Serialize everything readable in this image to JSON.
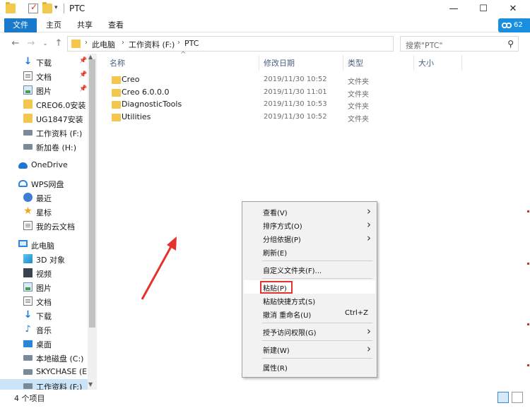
{
  "window": {
    "title": "PTC",
    "minimize": "—",
    "maximize": "☐",
    "close": "✕"
  },
  "ribbon": {
    "tabs": [
      "文件",
      "主页",
      "共享",
      "查看"
    ],
    "badge": "62"
  },
  "address": {
    "crumbs": [
      "此电脑",
      "工作资料 (F:)",
      "PTC"
    ],
    "separator": "›",
    "search_placeholder": "搜索\"PTC\""
  },
  "sidebar": {
    "items": [
      {
        "label": "下载",
        "icon": "download-arrow-icon",
        "pinned": true
      },
      {
        "label": "文档",
        "icon": "document-icon",
        "pinned": true
      },
      {
        "label": "图片",
        "icon": "picture-icon",
        "pinned": true
      },
      {
        "label": "CREO6.0安装",
        "icon": "folder-icon"
      },
      {
        "label": "UG1847安装",
        "icon": "folder-icon"
      },
      {
        "label": "工作资料 (F:)",
        "icon": "drive-icon"
      },
      {
        "label": "新加卷 (H:)",
        "icon": "drive-icon"
      },
      {
        "label": "OneDrive",
        "icon": "cloud-icon"
      },
      {
        "label": "WPS网盘",
        "icon": "wps-cloud-icon"
      },
      {
        "label": "最近",
        "icon": "clock-icon"
      },
      {
        "label": "星标",
        "icon": "star-icon"
      },
      {
        "label": "我的云文档",
        "icon": "document-icon"
      },
      {
        "label": "此电脑",
        "icon": "computer-icon"
      },
      {
        "label": "3D 对象",
        "icon": "3d-objects-icon"
      },
      {
        "label": "视频",
        "icon": "video-icon"
      },
      {
        "label": "图片",
        "icon": "picture-icon"
      },
      {
        "label": "文档",
        "icon": "document-icon"
      },
      {
        "label": "下载",
        "icon": "download-arrow-icon"
      },
      {
        "label": "音乐",
        "icon": "music-icon"
      },
      {
        "label": "桌面",
        "icon": "desktop-icon"
      },
      {
        "label": "本地磁盘 (C:)",
        "icon": "drive-icon"
      },
      {
        "label": "SKYCHASE (E:)",
        "icon": "drive-icon"
      },
      {
        "label": "工作资料 (F:)",
        "icon": "drive-icon",
        "selected": true
      }
    ]
  },
  "columns": {
    "name": "名称",
    "date": "修改日期",
    "type": "类型",
    "size": "大小"
  },
  "files": [
    {
      "name": "Creo",
      "date": "2019/11/30 10:52",
      "type": "文件夹"
    },
    {
      "name": "Creo 6.0.0.0",
      "date": "2019/11/30 11:01",
      "type": "文件夹"
    },
    {
      "name": "DiagnosticTools",
      "date": "2019/11/30 10:53",
      "type": "文件夹"
    },
    {
      "name": "Utilities",
      "date": "2019/11/30 10:52",
      "type": "文件夹"
    }
  ],
  "context_menu": {
    "items": [
      {
        "label": "查看(V)",
        "submenu": true
      },
      {
        "label": "排序方式(O)",
        "submenu": true
      },
      {
        "label": "分组依据(P)",
        "submenu": true
      },
      {
        "label": "刷新(E)"
      },
      {
        "label": "自定义文件夹(F)..."
      },
      {
        "label": "粘贴(P)",
        "highlighted": true
      },
      {
        "label": "粘贴快捷方式(S)"
      },
      {
        "label": "撤消 重命名(U)",
        "shortcut": "Ctrl+Z"
      },
      {
        "label": "授予访问权限(G)",
        "submenu": true
      },
      {
        "label": "新建(W)",
        "submenu": true
      },
      {
        "label": "属性(R)"
      }
    ]
  },
  "status": {
    "item_count": "4 个项目"
  },
  "colors": {
    "accent": "#1979ca",
    "annotation": "#e5322d",
    "folder": "#f4c64e",
    "selection": "#cce4f7"
  }
}
